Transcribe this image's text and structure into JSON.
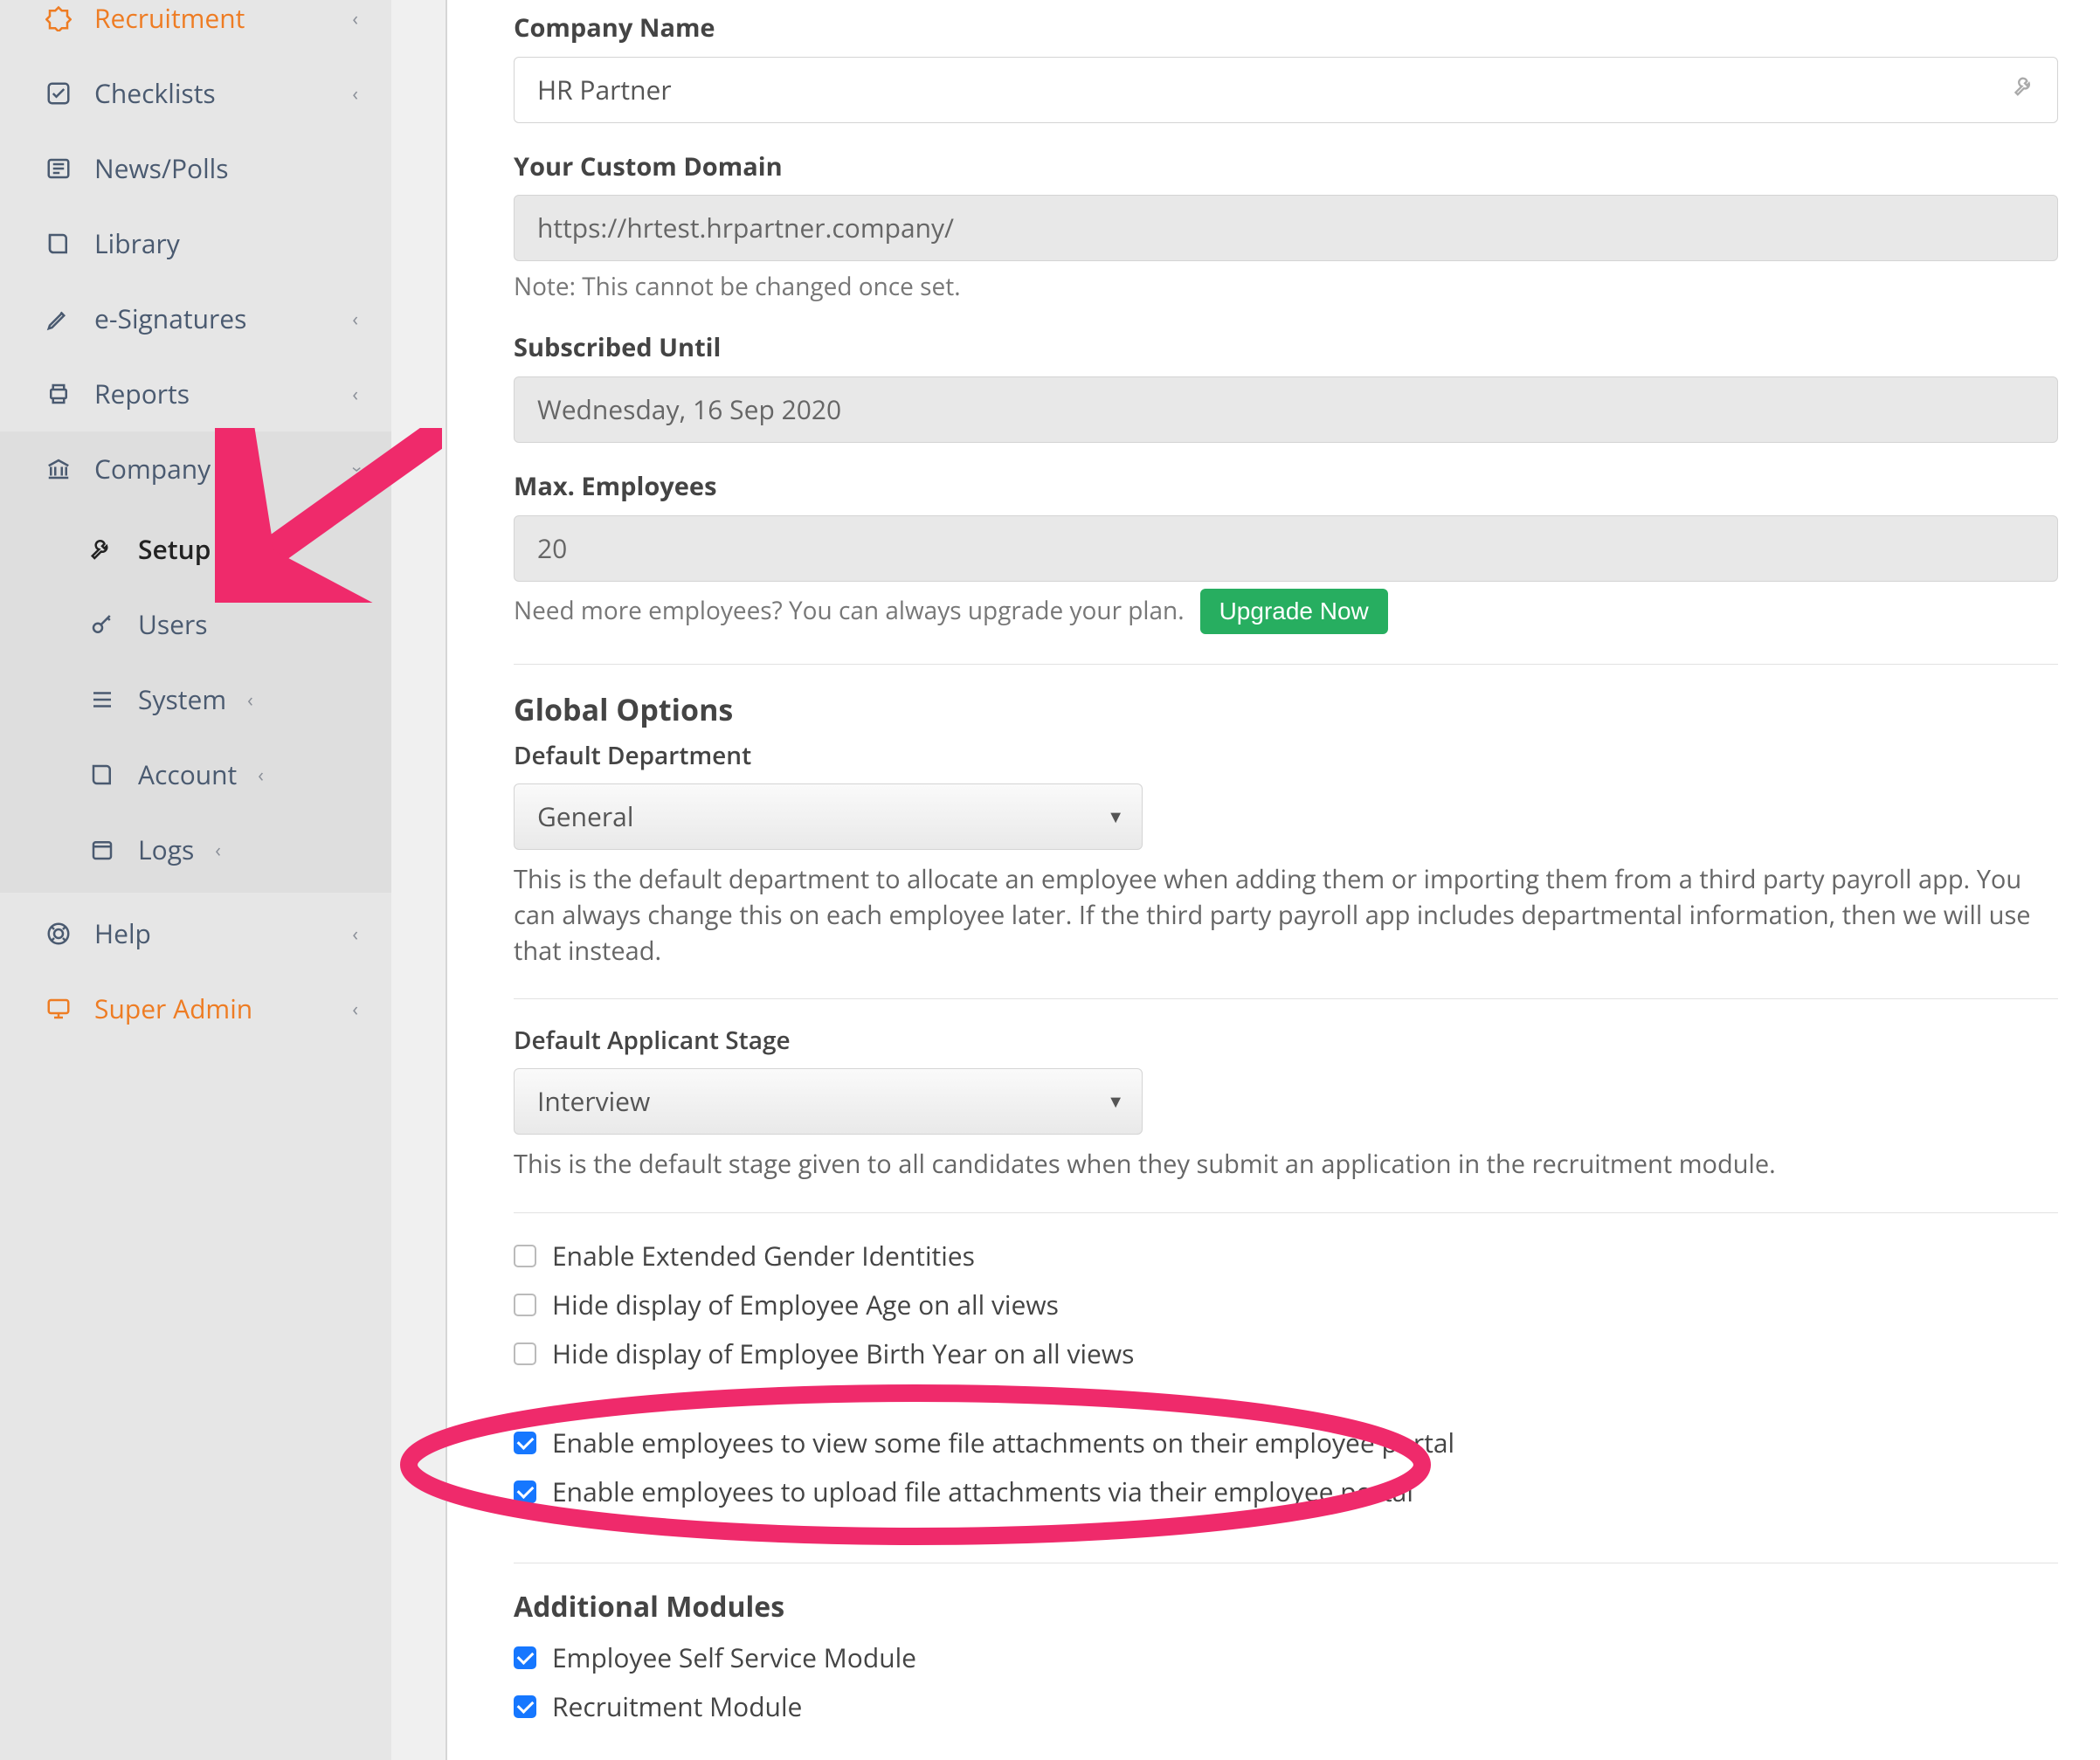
{
  "sidebar": {
    "items": [
      {
        "id": "recruitment",
        "label": "Recruitment",
        "hasChevron": true
      },
      {
        "id": "checklists",
        "label": "Checklists",
        "hasChevron": true
      },
      {
        "id": "newspolls",
        "label": "News/Polls",
        "hasChevron": false
      },
      {
        "id": "library",
        "label": "Library",
        "hasChevron": false
      },
      {
        "id": "esignatures",
        "label": "e-Signatures",
        "hasChevron": true
      },
      {
        "id": "reports",
        "label": "Reports",
        "hasChevron": true
      },
      {
        "id": "company",
        "label": "Company",
        "hasChevron": true
      }
    ],
    "company_sub": [
      {
        "id": "setup",
        "label": "Setup",
        "active": true
      },
      {
        "id": "users",
        "label": "Users",
        "hasChevron": false
      },
      {
        "id": "system",
        "label": "System",
        "hasChevron": true
      },
      {
        "id": "account",
        "label": "Account",
        "hasChevron": true
      },
      {
        "id": "logs",
        "label": "Logs",
        "hasChevron": true
      }
    ],
    "help": {
      "label": "Help"
    },
    "super": {
      "label": "Super Admin"
    }
  },
  "form": {
    "company_name_label": "Company Name",
    "company_name_value": "HR Partner",
    "custom_domain_label": "Your Custom Domain",
    "custom_domain_value": "https://hrtest.hrpartner.company/",
    "custom_domain_note": "Note: This cannot be changed once set.",
    "subscribed_label": "Subscribed Until",
    "subscribed_value": "Wednesday, 16 Sep 2020",
    "max_emp_label": "Max. Employees",
    "max_emp_value": "20",
    "max_emp_help": "Need more employees? You can always upgrade your plan.",
    "upgrade_btn": "Upgrade Now"
  },
  "global": {
    "title": "Global Options",
    "dept_label": "Default Department",
    "dept_value": "General",
    "dept_help": "This is the default department to allocate an employee when adding them or importing them from a third party payroll app. You can always change this on each employee later. If the third party payroll app includes departmental information, then we will use that instead.",
    "stage_label": "Default Applicant Stage",
    "stage_value": "Interview",
    "stage_help": "This is the default stage given to all candidates when they submit an application in the recruitment module."
  },
  "checks1": [
    {
      "label": "Enable Extended Gender Identities",
      "checked": false
    },
    {
      "label": "Hide display of Employee Age on all views",
      "checked": false
    },
    {
      "label": "Hide display of Employee Birth Year on all views",
      "checked": false
    }
  ],
  "checks2": [
    {
      "label": "Enable employees to view some file attachments on their employee portal",
      "checked": true
    },
    {
      "label": "Enable employees to upload file attachments via their employee portal",
      "checked": true
    }
  ],
  "modules": {
    "title": "Additional Modules",
    "items": [
      {
        "label": "Employee Self Service Module",
        "checked": true
      },
      {
        "label": "Recruitment Module",
        "checked": true
      }
    ]
  },
  "annotations": {
    "arrow_color": "#ef2a6b",
    "ellipse_color": "#ef2a6b"
  }
}
